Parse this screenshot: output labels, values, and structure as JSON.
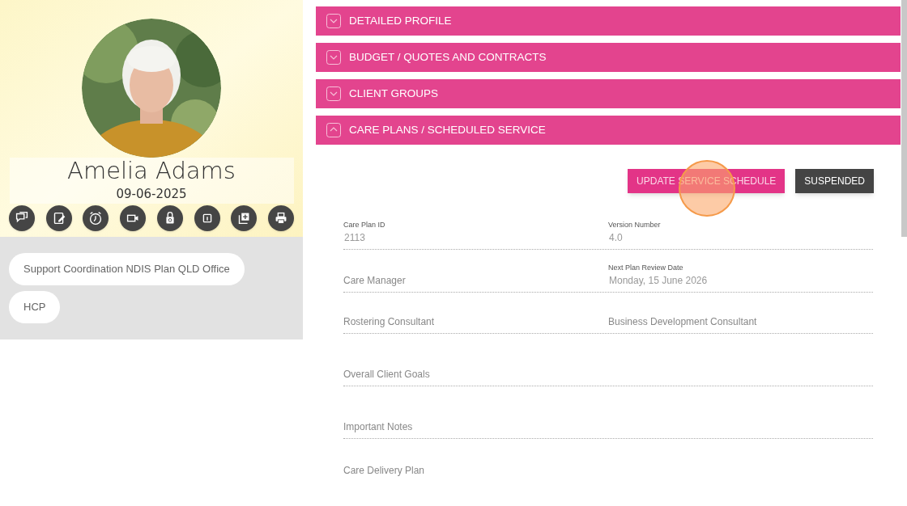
{
  "profile": {
    "name": "Amelia Adams",
    "date": "09-06-2025",
    "actions": [
      {
        "kind": "chat"
      },
      {
        "kind": "edit"
      },
      {
        "kind": "alarm"
      },
      {
        "kind": "video"
      },
      {
        "kind": "lock"
      },
      {
        "kind": "info"
      },
      {
        "kind": "add"
      },
      {
        "kind": "print"
      }
    ],
    "groups": [
      "Support Coordination NDIS Plan QLD Office",
      "HCP"
    ]
  },
  "sections": [
    {
      "title": "DETAILED PROFILE",
      "expanded": false
    },
    {
      "title": "BUDGET / QUOTES AND CONTRACTS",
      "expanded": false
    },
    {
      "title": "CLIENT GROUPS",
      "expanded": false
    },
    {
      "title": "CARE PLANS / SCHEDULED SERVICE",
      "expanded": true
    }
  ],
  "buttons": [
    {
      "label": "UPDATE SERVICE SCHEDULE",
      "kind": "primary"
    },
    {
      "label": "SUSPENDED",
      "kind": "dark"
    }
  ],
  "field_rows": [
    [
      {
        "label": "Care Plan ID",
        "value": "2113"
      },
      {
        "label": "Version Number",
        "value": "4.0"
      }
    ],
    [
      {
        "label": "Care Manager"
      },
      {
        "label": "Next Plan Review Date",
        "value": "Monday, 15 June 2026"
      }
    ],
    [
      {
        "label": "Rostering Consultant"
      },
      {
        "label": "Business Development Consultant"
      }
    ],
    [
      {
        "label": "Overall Client Goals"
      }
    ],
    [
      {
        "label": "Important Notes"
      }
    ],
    [
      {
        "label": "Care Delivery Plan"
      }
    ]
  ]
}
